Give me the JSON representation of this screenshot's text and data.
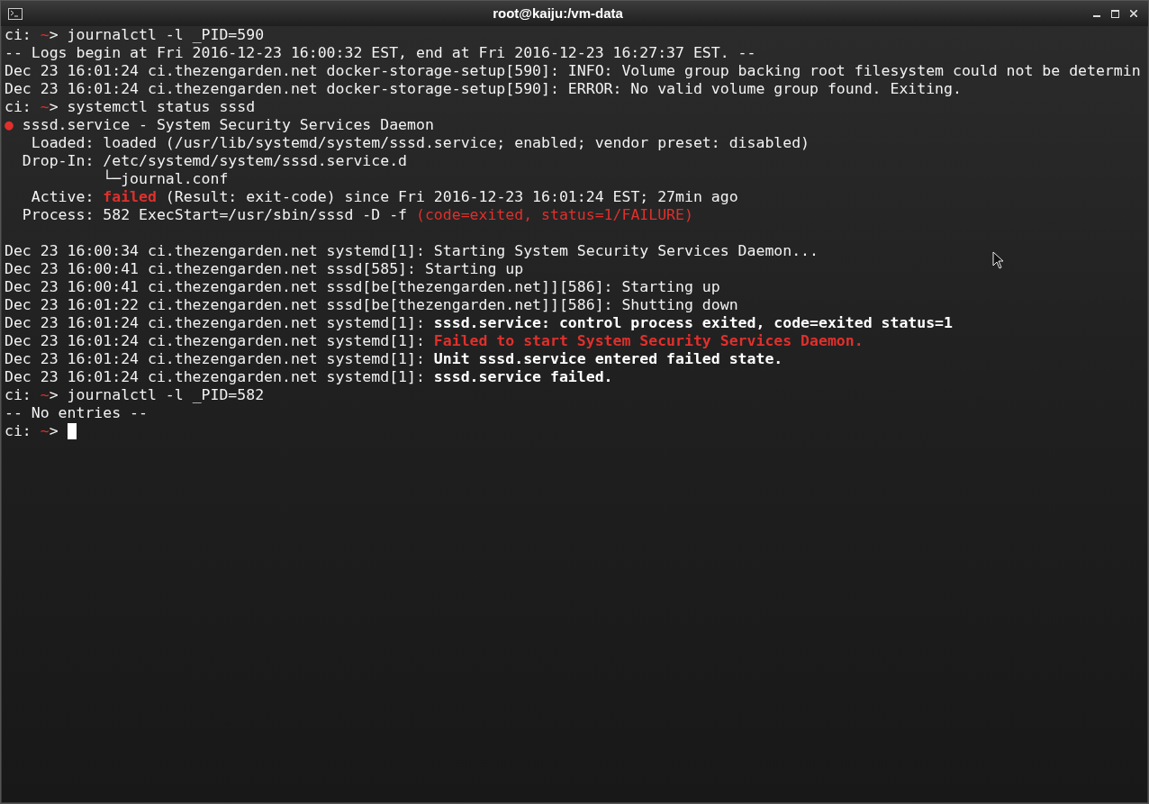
{
  "window": {
    "title": "root@kaiju:/vm-data"
  },
  "terminal": {
    "cursor_visible": true,
    "lines": [
      {
        "kind": "text",
        "segments": [
          {
            "text": "ci: ",
            "kind": "plain"
          },
          {
            "text": "~",
            "kind": "red"
          },
          {
            "text": "> journalctl -l _PID=590",
            "kind": "plain"
          }
        ]
      },
      {
        "kind": "text",
        "segments": [
          {
            "text": "-- Logs begin at Fri 2016-12-23 16:00:32 EST, end at Fri 2016-12-23 16:27:37 EST. --",
            "kind": "plain"
          }
        ]
      },
      {
        "kind": "text",
        "segments": [
          {
            "text": "Dec 23 16:01:24 ci.thezengarden.net docker-storage-setup[590]: INFO: Volume group backing root filesystem could not be determin",
            "kind": "plain"
          }
        ]
      },
      {
        "kind": "text",
        "segments": [
          {
            "text": "Dec 23 16:01:24 ci.thezengarden.net docker-storage-setup[590]: ERROR: No valid volume group found. Exiting.",
            "kind": "plain"
          }
        ]
      },
      {
        "kind": "text",
        "segments": [
          {
            "text": "ci: ",
            "kind": "plain"
          },
          {
            "text": "~",
            "kind": "red"
          },
          {
            "text": "> systemctl status sssd",
            "kind": "plain"
          }
        ]
      },
      {
        "kind": "text",
        "segments": [
          {
            "text": "●",
            "kind": "red"
          },
          {
            "text": " sssd.service - System Security Services Daemon",
            "kind": "plain"
          }
        ]
      },
      {
        "kind": "text",
        "segments": [
          {
            "text": "   Loaded: loaded (/usr/lib/systemd/system/sssd.service; enabled; vendor preset: disabled)",
            "kind": "plain"
          }
        ]
      },
      {
        "kind": "text",
        "segments": [
          {
            "text": "  Drop-In: /etc/systemd/system/sssd.service.d",
            "kind": "plain"
          }
        ]
      },
      {
        "kind": "text",
        "segments": [
          {
            "text": "           └─journal.conf",
            "kind": "plain"
          }
        ]
      },
      {
        "kind": "text",
        "segments": [
          {
            "text": "   Active: ",
            "kind": "plain"
          },
          {
            "text": "failed",
            "kind": "red_bold"
          },
          {
            "text": " (Result: exit-code) since Fri 2016-12-23 16:01:24 EST; 27min ago",
            "kind": "plain"
          }
        ]
      },
      {
        "kind": "text",
        "segments": [
          {
            "text": "  Process: 582 ExecStart=/usr/sbin/sssd -D -f ",
            "kind": "plain"
          },
          {
            "text": "(code=exited, status=1/FAILURE)",
            "kind": "red"
          }
        ]
      },
      {
        "kind": "blank"
      },
      {
        "kind": "text",
        "segments": [
          {
            "text": "Dec 23 16:00:34 ci.thezengarden.net systemd[1]: Starting System Security Services Daemon...",
            "kind": "plain"
          }
        ]
      },
      {
        "kind": "text",
        "segments": [
          {
            "text": "Dec 23 16:00:41 ci.thezengarden.net sssd[585]: Starting up",
            "kind": "plain"
          }
        ]
      },
      {
        "kind": "text",
        "segments": [
          {
            "text": "Dec 23 16:00:41 ci.thezengarden.net sssd[be[thezengarden.net]][586]: Starting up",
            "kind": "plain"
          }
        ]
      },
      {
        "kind": "text",
        "segments": [
          {
            "text": "Dec 23 16:01:22 ci.thezengarden.net sssd[be[thezengarden.net]][586]: Shutting down",
            "kind": "plain"
          }
        ]
      },
      {
        "kind": "text",
        "segments": [
          {
            "text": "Dec 23 16:01:24 ci.thezengarden.net systemd[1]: ",
            "kind": "plain"
          },
          {
            "text": "sssd.service: control process exited, code=exited status=1",
            "kind": "bold"
          }
        ]
      },
      {
        "kind": "text",
        "segments": [
          {
            "text": "Dec 23 16:01:24 ci.thezengarden.net systemd[1]: ",
            "kind": "plain"
          },
          {
            "text": "Failed to start System Security Services Daemon.",
            "kind": "red_bold"
          }
        ]
      },
      {
        "kind": "text",
        "segments": [
          {
            "text": "Dec 23 16:01:24 ci.thezengarden.net systemd[1]: ",
            "kind": "plain"
          },
          {
            "text": "Unit sssd.service entered failed state.",
            "kind": "bold"
          }
        ]
      },
      {
        "kind": "text",
        "segments": [
          {
            "text": "Dec 23 16:01:24 ci.thezengarden.net systemd[1]: ",
            "kind": "plain"
          },
          {
            "text": "sssd.service failed.",
            "kind": "bold"
          }
        ]
      },
      {
        "kind": "text",
        "segments": [
          {
            "text": "ci: ",
            "kind": "plain"
          },
          {
            "text": "~",
            "kind": "red"
          },
          {
            "text": "> journalctl -l _PID=582",
            "kind": "plain"
          }
        ]
      },
      {
        "kind": "text",
        "segments": [
          {
            "text": "-- No entries --",
            "kind": "plain"
          }
        ]
      },
      {
        "kind": "text",
        "segments": [
          {
            "text": "ci: ",
            "kind": "plain"
          },
          {
            "text": "~",
            "kind": "red"
          },
          {
            "text": "> ",
            "kind": "plain"
          }
        ]
      }
    ]
  }
}
